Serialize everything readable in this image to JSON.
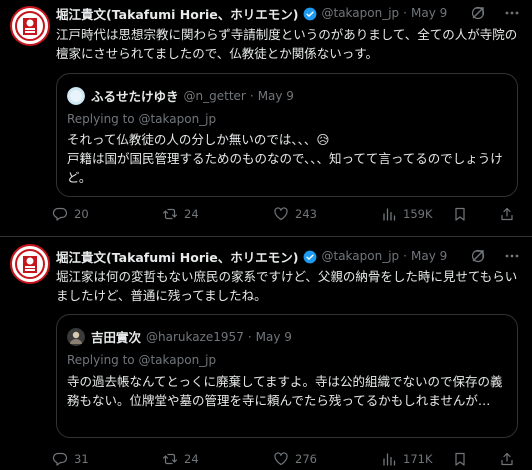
{
  "tweets": [
    {
      "author_name": "堀江貴文(Takafumi Horie、ホリエモン)",
      "handle": "@takapon_jp",
      "date": "May 9",
      "text": "江戸時代は思想宗教に関わらず寺請制度というのがありまして、全ての人が寺院の檀家にさせられてましたので、仏教徒とか関係ないっす。",
      "quote": {
        "author_name": "ふるせたけゆき",
        "handle": "@n_getter",
        "date": "May 9",
        "replying_to": "Replying to @takapon_jp",
        "text": "それって仏教徒の人の分しか無いのでは、、、😥\n戸籍は国が国民管理するためのものなので、、、知ってて言ってるのでしょうけど。"
      },
      "stats": {
        "replies": "20",
        "retweets": "24",
        "likes": "243",
        "views": "159K"
      }
    },
    {
      "author_name": "堀江貴文(Takafumi Horie、ホリエモン)",
      "handle": "@takapon_jp",
      "date": "May 9",
      "text": "堀江家は何の変哲もない庶民の家系ですけど、父親の納骨をした時に見せてもらいましたけど、普通に残ってましたね。",
      "quote": {
        "author_name": "吉田實次",
        "handle": "@harukaze1957",
        "date": "May 9",
        "replying_to": "Replying to @takapon_jp",
        "text": "寺の過去帳なんてとっくに廃棄してますよ。寺は公的組織でないので保存の義務もない。位牌堂や墓の管理を寺に頼んでたら残ってるかもしれませんが…"
      },
      "stats": {
        "replies": "31",
        "retweets": "24",
        "likes": "276",
        "views": "171K"
      }
    }
  ],
  "colors": {
    "background": "#000000",
    "text": "#e7e9ea",
    "muted": "#71767b",
    "border": "#2f3336",
    "verified": "#1d9bf0"
  }
}
